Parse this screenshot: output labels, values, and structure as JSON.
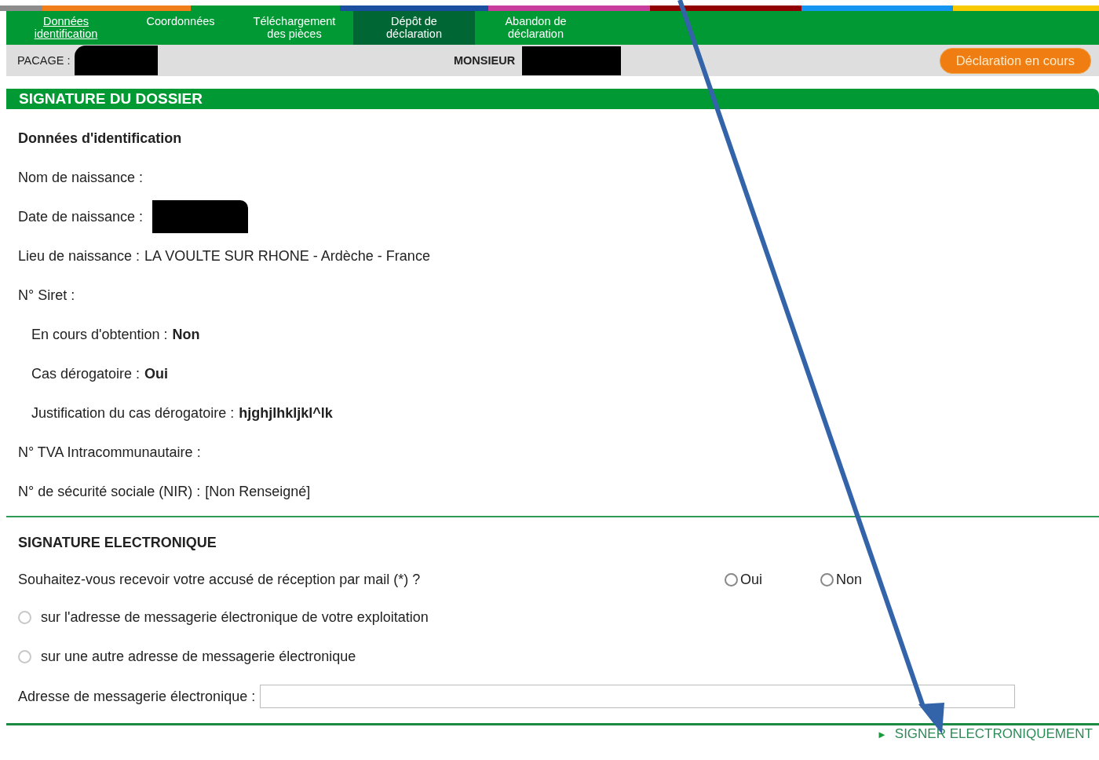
{
  "tabs": [
    {
      "label": "Données identification",
      "selected": false,
      "underlined": true
    },
    {
      "label": "Coordonnées",
      "selected": false,
      "underlined": false
    },
    {
      "label": "Téléchargement des pièces",
      "selected": false,
      "underlined": false
    },
    {
      "label": "Dépôt de déclaration",
      "selected": true,
      "underlined": false
    },
    {
      "label": "Abandon de déclaration",
      "selected": false,
      "underlined": false
    }
  ],
  "info_bar": {
    "pacage_label": "PACAGE :",
    "pacage_redacted": true,
    "name_label": "MONSIEUR",
    "name_redacted": true,
    "status": "Déclaration en cours"
  },
  "section_title": "SIGNATURE DU DOSSIER",
  "identification": {
    "title": "Données d'identification",
    "fields": [
      {
        "label": "Nom de naissance :",
        "redacted": false
      },
      {
        "label": "Date de naissance :",
        "redacted": true
      },
      {
        "label": "Lieu de naissance :",
        "value": "LA VOULTE SUR RHONE - Ardèche - France",
        "bold": false,
        "redacted": false
      },
      {
        "label": "N° Siret :",
        "redacted": false,
        "children": [
          {
            "label": "En cours d'obtention :",
            "value": "Non",
            "bold": true,
            "redacted": false
          },
          {
            "label": "Cas dérogatoire :",
            "value": "Oui",
            "bold": true,
            "redacted": false
          },
          {
            "label": "Justification du cas dérogatoire :",
            "value": "hjghjlhkljkl^lk",
            "bold": true,
            "redacted": false
          }
        ]
      },
      {
        "label": "N° TVA Intracommunautaire :",
        "redacted": false
      },
      {
        "label": "N° de sécurité sociale (NIR) :",
        "value": "[Non Renseigné]",
        "bold": false,
        "redacted": false
      }
    ]
  },
  "signature": {
    "title": "SIGNATURE ELECTRONIQUE",
    "question": "Souhaitez-vous recevoir votre accusé de réception par mail (*) ?",
    "answers": [
      {
        "label": "Oui",
        "checked": false
      },
      {
        "label": "Non",
        "checked": false
      }
    ],
    "address_options": [
      {
        "label": "sur l'adresse de messagerie électronique de votre exploitation",
        "checked": false
      },
      {
        "label": "sur une autre adresse de messagerie électronique",
        "checked": false
      }
    ],
    "email_label": "Adresse de messagerie électronique :"
  },
  "action": {
    "icon": "►",
    "label": "SIGNER ELECTRONIQUEMENT"
  }
}
